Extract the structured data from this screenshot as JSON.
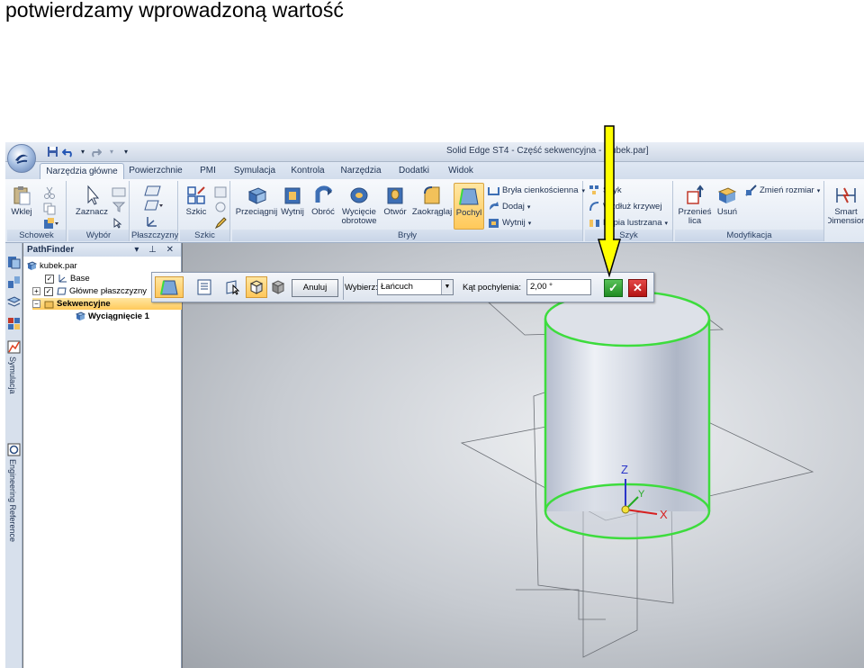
{
  "caption": "potwierdzamy wprowadzoną wartość",
  "window": {
    "title": "Solid Edge ST4 - Część sekwencyjna - [kubek.par]"
  },
  "tabs": [
    "Narzędzia główne",
    "Powierzchnie",
    "PMI",
    "Symulacja",
    "Kontrola",
    "Narzędzia",
    "Dodatki",
    "Widok"
  ],
  "active_tab": "Narzędzia główne",
  "ribbon": {
    "groups": [
      "Schowek",
      "Wybór",
      "Płaszczyzny",
      "Szkic",
      "Bryły",
      "Szyk",
      "Modyfikacja"
    ],
    "clipboard": {
      "paste": "Wklej"
    },
    "select": {
      "select": "Zaznacz"
    },
    "sketch": {
      "sketch": "Szkic"
    },
    "solids": {
      "extrude": "Przeciągnij",
      "cut": "Wytnij",
      "revolve": "Obróć",
      "revolved_cut": "Wycięcie obrotowe",
      "hole": "Otwór",
      "round": "Zaokrąglaj",
      "draft": "Pochyl",
      "thin_wall": "Bryła cienkościenna",
      "add": "Dodaj",
      "cut_small": "Wytnij"
    },
    "pattern": {
      "pattern": "Szyk",
      "along_curve": "Wzdłuż krzywej",
      "mirror": "Kopia lustrzana"
    },
    "modify": {
      "move_faces": "Przenieś lica",
      "delete": "Usuń",
      "resize": "Zmień rozmiar"
    },
    "smart_dimension": "Smart Dimension"
  },
  "pathfinder": {
    "title": "PathFinder",
    "controls": "▾ ⊥ ✕",
    "tree": [
      {
        "label": "kubek.par"
      },
      {
        "label": "Base"
      },
      {
        "label": "Główne płaszczyzny"
      },
      {
        "label": "Sekwencyjne"
      },
      {
        "label": "Wyciągnięcie 1"
      }
    ]
  },
  "sidebar_tabs": [
    "Symulacja",
    "Engineering Reference"
  ],
  "command_bar": {
    "cancel": "Anuluj",
    "select_label": "Wybierz:",
    "select_value": "Łańcuch",
    "angle_label": "Kąt pochylenia:",
    "angle_value": "2,00 °"
  },
  "viewport": {
    "axes": {
      "x": "X",
      "y": "Y",
      "z": "Z"
    }
  },
  "colors": {
    "highlight": "#ffc95a",
    "accept": "#1f8b22",
    "reject": "#b31414",
    "selection_edge": "#3ddc3d",
    "annotation_arrow": "#ffff00"
  }
}
